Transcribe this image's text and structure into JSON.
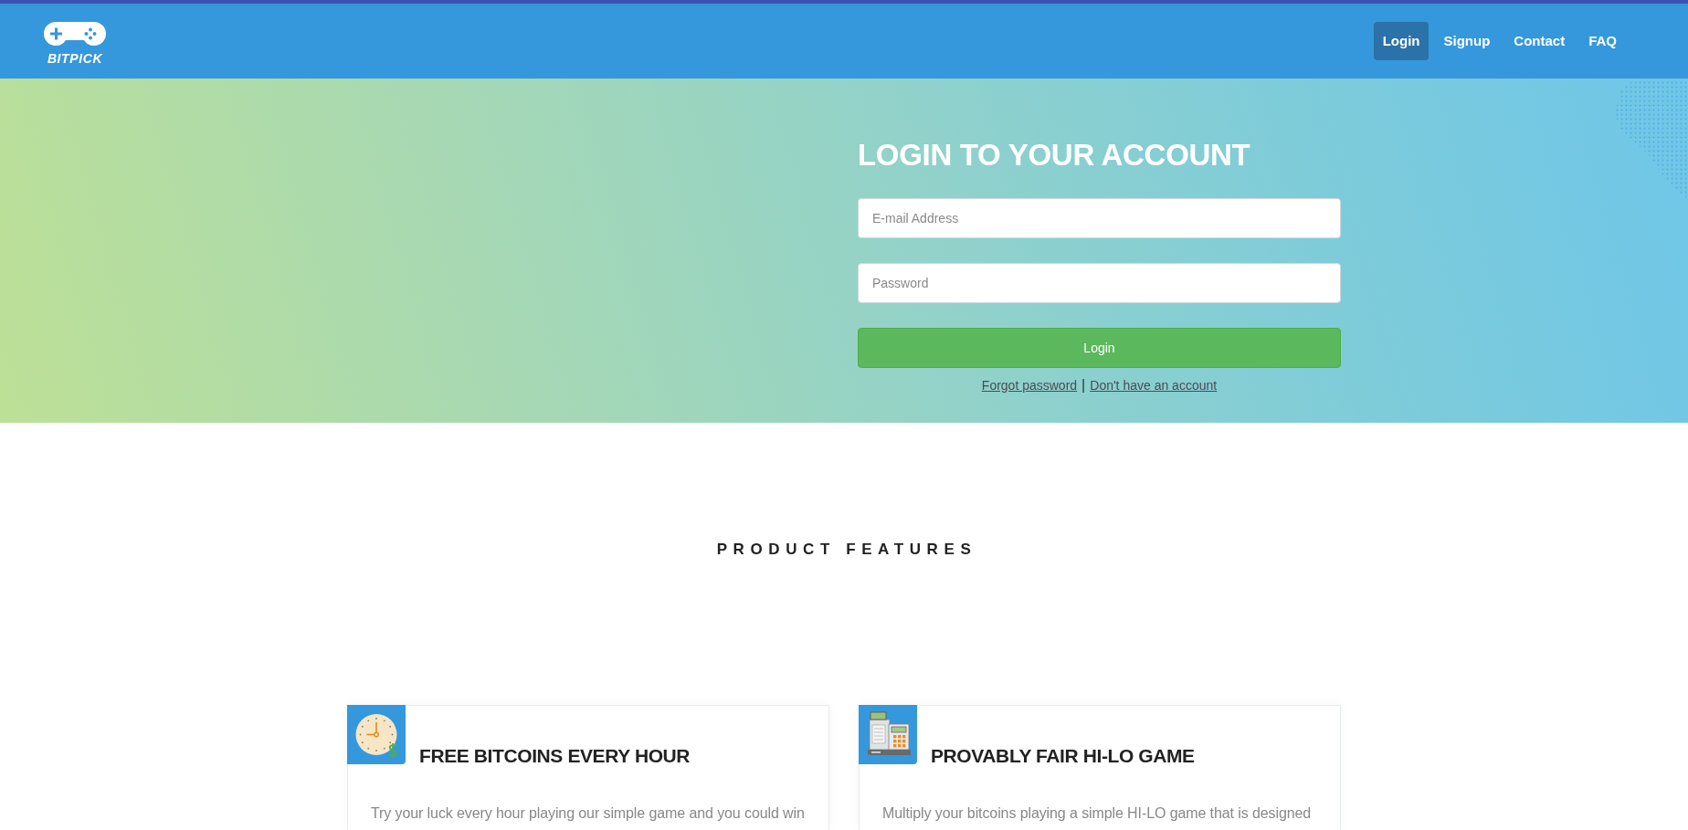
{
  "navbar": {
    "brand": "BITPICK",
    "links": [
      {
        "label": "Login",
        "selected": true
      },
      {
        "label": "Signup",
        "selected": false
      },
      {
        "label": "Contact",
        "selected": false
      },
      {
        "label": "FAQ",
        "selected": false
      }
    ]
  },
  "login_form": {
    "title": "LOGIN TO YOUR ACCOUNT",
    "fields": [
      {
        "placeholder": "E-mail Address"
      },
      {
        "placeholder": "Password"
      }
    ],
    "submit": "Login",
    "links": [
      "Forgot password",
      "Don't have an account"
    ],
    "separator": "|"
  },
  "features": {
    "title": "PRODUCT FEATURES",
    "cards": [
      {
        "kind": "clock",
        "title": "FREE BITCOINS EVERY HOUR",
        "text": "Try your luck every hour playing our simple game and you could win"
      },
      {
        "kind": "register",
        "title": "PROVABLY FAIR HI-LO GAME",
        "text": "Multiply your bitcoins playing a simple HI-LO game that is designed"
      }
    ]
  }
}
